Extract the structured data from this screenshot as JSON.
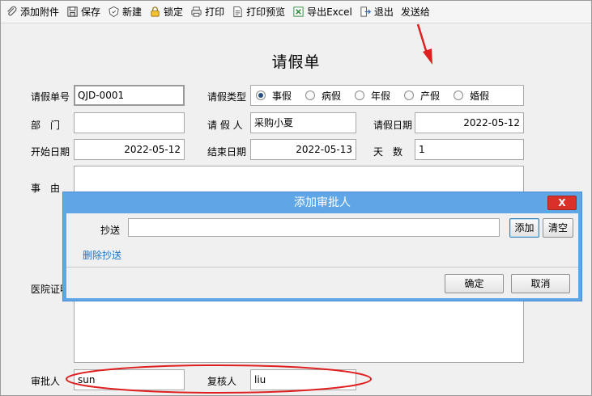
{
  "toolbar": {
    "items": [
      {
        "label": "添加附件",
        "icon": "paperclip-icon"
      },
      {
        "label": "保存",
        "icon": "save-icon"
      },
      {
        "label": "新建",
        "icon": "new-icon"
      },
      {
        "label": "锁定",
        "icon": "lock-icon"
      },
      {
        "label": "打印",
        "icon": "printer-icon"
      },
      {
        "label": "打印预览",
        "icon": "print-preview-icon"
      },
      {
        "label": "导出Excel",
        "icon": "excel-icon"
      },
      {
        "label": "退出",
        "icon": "exit-icon"
      },
      {
        "label": "发送给",
        "icon": ""
      }
    ]
  },
  "form": {
    "title": "请假单",
    "labels": {
      "leave_no": "请假单号",
      "leave_type": "请假类型",
      "department": "部　门",
      "applicant": "请 假 人",
      "leave_date": "请假日期",
      "start_date": "开始日期",
      "end_date": "结束日期",
      "days": "天　数",
      "reason": "事　由",
      "hospital_cert": "医院证明",
      "approver": "审批人",
      "reviewer": "复核人"
    },
    "values": {
      "leave_no": "QJD-0001",
      "department": "",
      "applicant": "采购小夏",
      "leave_date": "2022-05-12",
      "start_date": "2022-05-12",
      "end_date": "2022-05-13",
      "days": "1",
      "reason": "",
      "approver": "sun",
      "reviewer": "liu"
    },
    "leave_types": [
      "事假",
      "病假",
      "年假",
      "产假",
      "婚假"
    ],
    "selected_leave_type": "事假"
  },
  "dialog": {
    "title": "添加审批人",
    "close_label": "X",
    "cc_label": "抄送",
    "cc_value": "",
    "add_button": "添加",
    "clear_button": "清空",
    "delete_cc_link": "删除抄送",
    "ok_button": "确定",
    "cancel_button": "取消"
  },
  "colors": {
    "dialog_title_bar": "#5fa6e6",
    "close_button": "#d9302a",
    "annotation": "#e02020",
    "link": "#1a73c9"
  }
}
